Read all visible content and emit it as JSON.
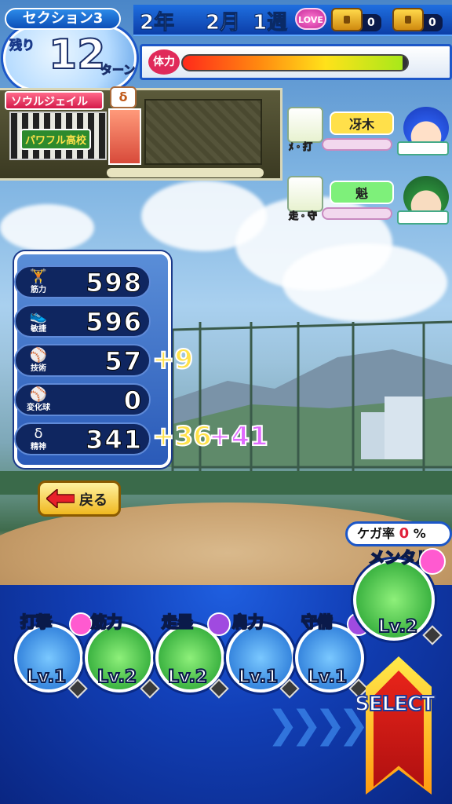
{
  "header": {
    "section": "セクション3",
    "remain_label": "残り",
    "turns": "12",
    "turns_suffix": "ターン",
    "year": "2年",
    "month": "2月",
    "week": "1週",
    "love_label": "LOVE",
    "chest1_count": "0",
    "chest2_count": "0"
  },
  "stamina": {
    "label": "体力",
    "level": 0.98
  },
  "event": {
    "tag": "ソウルジェイル",
    "school_name": "パワフル高校",
    "icon": "spirit-icon"
  },
  "teammates": [
    {
      "skill_label": "ﾒ・打",
      "name": "冴木",
      "name_color": "#ffe04a",
      "face": "blue-hair-face"
    },
    {
      "skill_label": "走・守",
      "name": "魁",
      "name_color": "#7ef07a",
      "face": "green-hair-face"
    }
  ],
  "stats": [
    {
      "label": "筋力",
      "icon": "dumbbell-icon",
      "glyph": "🏋",
      "value": "598",
      "bonus": []
    },
    {
      "label": "敏捷",
      "icon": "shoe-icon",
      "glyph": "👟",
      "value": "596",
      "bonus": []
    },
    {
      "label": "技術",
      "icon": "bat-icon",
      "glyph": "⚾",
      "value": "57",
      "bonus": [
        {
          "text": "+9",
          "color": "#ffe24a"
        }
      ]
    },
    {
      "label": "変化球",
      "icon": "ball-icon",
      "glyph": "⚾",
      "value": "0",
      "bonus": []
    },
    {
      "label": "精神",
      "icon": "spirit-icon",
      "glyph": "δ",
      "value": "341",
      "bonus": [
        {
          "text": "+36",
          "color": "#ffe24a"
        },
        {
          "text": "+41",
          "color": "#e06aff"
        }
      ]
    }
  ],
  "back_button": {
    "label": "戻る"
  },
  "injury": {
    "label": "ケガ率",
    "value": "0",
    "unit": "%"
  },
  "training": [
    {
      "name": "打撃",
      "level": "Lv.1",
      "icon": "bat-icon",
      "color": "#3a9ae0",
      "bubble": "#ff5ad0"
    },
    {
      "name": "筋力",
      "level": "Lv.2",
      "icon": "dumbbell-icon",
      "color": "#3ac048",
      "bubble": ""
    },
    {
      "name": "走塁",
      "level": "Lv.2",
      "icon": "base-icon",
      "color": "#3ac048",
      "bubble": "#a04ae0"
    },
    {
      "name": "肩力",
      "level": "Lv.1",
      "icon": "baseball-icon",
      "color": "#3a9ae0",
      "bubble": ""
    },
    {
      "name": "守備",
      "level": "Lv.1",
      "icon": "glove-icon",
      "color": "#3a9ae0",
      "bubble": "#a04ae0"
    },
    {
      "name": "メンタル",
      "level": "Lv.2",
      "icon": "cloud-icon",
      "color": "#3ac048",
      "bubble": "#ff5ad0"
    }
  ],
  "select_button": {
    "label": "SELECT"
  }
}
